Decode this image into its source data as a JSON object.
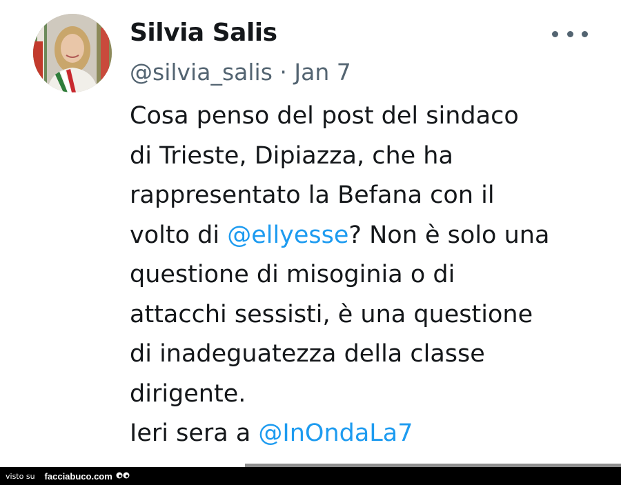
{
  "tweet": {
    "author": {
      "display_name": "Silvia Salis",
      "handle": "@silvia_salis"
    },
    "separator": "·",
    "date": "Jan 7",
    "more_icon": "more-horizontal-icon",
    "lines": [
      [
        {
          "t": "Cosa penso del post del sindaco"
        }
      ],
      [
        {
          "t": "di Trieste, Dipiazza, che ha"
        }
      ],
      [
        {
          "t": "rappresentato la Befana con il"
        }
      ],
      [
        {
          "t": "volto di "
        },
        {
          "t": "@ellyesse",
          "mention": true
        },
        {
          "t": "? Non è solo una"
        }
      ],
      [
        {
          "t": "questione di misoginia o di"
        }
      ],
      [
        {
          "t": "attacchi sessisti, è una questione"
        }
      ],
      [
        {
          "t": "di inadeguatezza della classe"
        }
      ],
      [
        {
          "t": "dirigente."
        }
      ],
      [
        {
          "t": "Ieri sera a "
        },
        {
          "t": "@InOndaLa7",
          "mention": true
        }
      ]
    ],
    "mention_color": "#1d9bf0"
  },
  "footer": {
    "visto_label": "visto su",
    "brand": "facciabuco.com"
  }
}
